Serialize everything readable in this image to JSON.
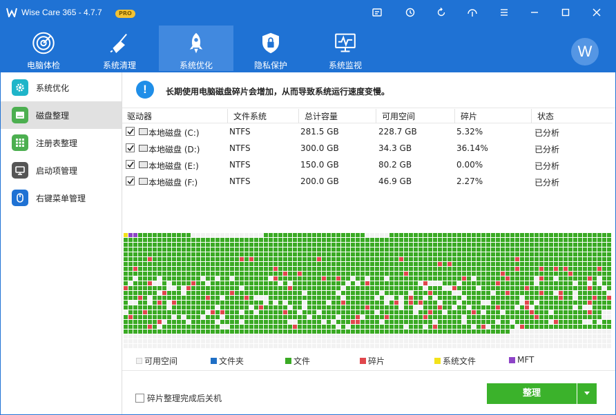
{
  "titlebar": {
    "title": "Wise Care 365 - 4.7.7",
    "badge": "PRO",
    "buttons": [
      "message-icon",
      "update-icon",
      "refresh-icon",
      "skin-icon",
      "menu-icon",
      "minimize-icon",
      "maximize-icon",
      "close-icon"
    ]
  },
  "nav": {
    "tabs": [
      {
        "label": "电脑体检",
        "icon": "radar-icon"
      },
      {
        "label": "系统清理",
        "icon": "broom-icon"
      },
      {
        "label": "系统优化",
        "icon": "rocket-icon",
        "active": true
      },
      {
        "label": "隐私保护",
        "icon": "shield-icon"
      },
      {
        "label": "系统监视",
        "icon": "monitor-icon"
      }
    ],
    "avatar_letter": "W"
  },
  "sidebar": {
    "items": [
      {
        "label": "系统优化",
        "icon": "gear-icon",
        "color": "#1fb5c9"
      },
      {
        "label": "磁盘整理",
        "icon": "disk-icon",
        "color": "#4caf50",
        "active": true
      },
      {
        "label": "注册表整理",
        "icon": "grid-icon",
        "color": "#4caf50"
      },
      {
        "label": "启动项管理",
        "icon": "startup-icon",
        "color": "#555555"
      },
      {
        "label": "右键菜单管理",
        "icon": "mouse-icon",
        "color": "#1f72d4"
      }
    ]
  },
  "notice": {
    "text": "长期使用电脑磁盘碎片会增加，从而导致系统运行速度变慢。"
  },
  "table": {
    "headers": [
      "驱动器",
      "文件系统",
      "总计容量",
      "可用空间",
      "碎片",
      "状态"
    ],
    "rows": [
      {
        "checked": true,
        "drive": "本地磁盘 (C:)",
        "fs": "NTFS",
        "total": "281.5 GB",
        "free": "228.7 GB",
        "frag": "5.32%",
        "status": "已分析"
      },
      {
        "checked": true,
        "drive": "本地磁盘 (D:)",
        "fs": "NTFS",
        "total": "300.0 GB",
        "free": "34.3 GB",
        "frag": "36.14%",
        "status": "已分析"
      },
      {
        "checked": true,
        "drive": "本地磁盘 (E:)",
        "fs": "NTFS",
        "total": "150.0 GB",
        "free": "80.2 GB",
        "frag": "0.00%",
        "status": "已分析"
      },
      {
        "checked": true,
        "drive": "本地磁盘 (F:)",
        "fs": "NTFS",
        "total": "200.0 GB",
        "free": "46.9 GB",
        "frag": "2.27%",
        "status": "已分析"
      }
    ]
  },
  "legend": {
    "items": [
      {
        "label": "可用空间",
        "color": "#f2f2f2"
      },
      {
        "label": "文件夹",
        "color": "#1f6fc5"
      },
      {
        "label": "文件",
        "color": "#3aaa24"
      },
      {
        "label": "碎片",
        "color": "#e0474c"
      },
      {
        "label": "系统文件",
        "color": "#f3e21a"
      },
      {
        "label": "MFT",
        "color": "#8e44c7"
      }
    ]
  },
  "footer": {
    "shutdown_label": "碎片整理完成后关机",
    "shutdown_checked": false,
    "defrag_label": "整理"
  }
}
